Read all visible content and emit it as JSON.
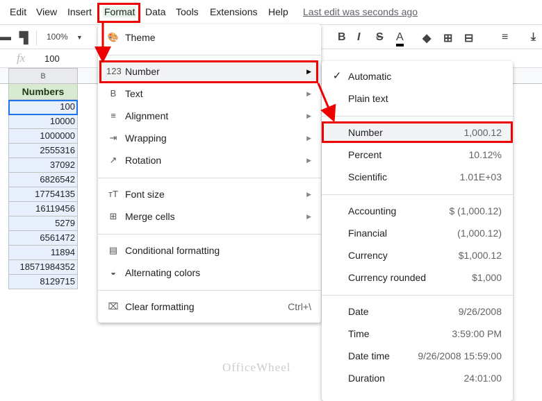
{
  "menubar": {
    "items": [
      "Edit",
      "View",
      "Insert",
      "Format",
      "Data",
      "Tools",
      "Extensions",
      "Help"
    ],
    "last_edit": "Last edit was seconds ago"
  },
  "toolbar": {
    "zoom": "100%",
    "bold": "B",
    "italic": "I",
    "strike": "S",
    "text_color": "A"
  },
  "formula_bar": {
    "fx": "fx",
    "value": "100"
  },
  "sheet": {
    "column": "B",
    "header": "Numbers",
    "values": [
      "100",
      "10000",
      "1000000",
      "2555316",
      "37092",
      "6826542",
      "17754135",
      "16119456",
      "5279",
      "6561472",
      "11894",
      "18571984352",
      "8129715"
    ]
  },
  "format_menu": {
    "items": [
      {
        "icon": "palette-icon",
        "glyph": "🎨",
        "label": "Theme"
      },
      {
        "icon": "123-icon",
        "glyph": "123",
        "label": "Number",
        "submenu": true
      },
      {
        "icon": "bold-icon",
        "glyph": "B",
        "label": "Text",
        "submenu": true
      },
      {
        "icon": "align-icon",
        "glyph": "≡",
        "label": "Alignment",
        "submenu": true
      },
      {
        "icon": "wrap-icon",
        "glyph": "⇥",
        "label": "Wrapping",
        "submenu": true
      },
      {
        "icon": "rotate-icon",
        "glyph": "↗",
        "label": "Rotation",
        "submenu": true
      },
      {
        "icon": "font-size-icon",
        "glyph": "тT",
        "label": "Font size",
        "submenu": true
      },
      {
        "icon": "merge-icon",
        "glyph": "⊞",
        "label": "Merge cells",
        "submenu": true
      },
      {
        "icon": "conditional-icon",
        "glyph": "▤",
        "label": "Conditional formatting"
      },
      {
        "icon": "drop-icon",
        "glyph": "◒",
        "label": "Alternating colors"
      },
      {
        "icon": "clear-format-icon",
        "glyph": "⌧",
        "label": "Clear formatting",
        "shortcut": "Ctrl+\\"
      }
    ]
  },
  "number_submenu": {
    "items": [
      {
        "label": "Automatic",
        "value": "",
        "checked": true
      },
      {
        "label": "Plain text",
        "value": ""
      },
      {
        "label": "Number",
        "value": "1,000.12"
      },
      {
        "label": "Percent",
        "value": "10.12%"
      },
      {
        "label": "Scientific",
        "value": "1.01E+03"
      },
      {
        "label": "Accounting",
        "value": "$ (1,000.12)"
      },
      {
        "label": "Financial",
        "value": "(1,000.12)"
      },
      {
        "label": "Currency",
        "value": "$1,000.12"
      },
      {
        "label": "Currency rounded",
        "value": "$1,000"
      },
      {
        "label": "Date",
        "value": "9/26/2008"
      },
      {
        "label": "Time",
        "value": "3:59:00 PM"
      },
      {
        "label": "Date time",
        "value": "9/26/2008 15:59:00"
      },
      {
        "label": "Duration",
        "value": "24:01:00"
      }
    ]
  },
  "watermark": "OfficeWheel",
  "colors": {
    "highlight": "#ee0000",
    "header_bg": "#d9ead3",
    "selection": "#e8f0fe"
  }
}
